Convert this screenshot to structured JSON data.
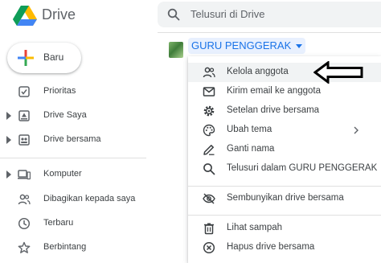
{
  "app": {
    "title": "Drive"
  },
  "search": {
    "placeholder": "Telusuri di Drive"
  },
  "new_button": {
    "label": "Baru"
  },
  "sidebar": {
    "items": [
      {
        "label": "Prioritas",
        "icon": "checkbox-icon",
        "expandable": false
      },
      {
        "label": "Drive Saya",
        "icon": "my-drive-icon",
        "expandable": true
      },
      {
        "label": "Drive bersama",
        "icon": "shared-drives-icon",
        "expandable": true
      },
      {
        "label": "Komputer",
        "icon": "computer-icon",
        "expandable": true
      },
      {
        "label": "Dibagikan kepada saya",
        "icon": "people-icon",
        "expandable": false
      },
      {
        "label": "Terbaru",
        "icon": "clock-icon",
        "expandable": false
      },
      {
        "label": "Berbintang",
        "icon": "star-icon",
        "expandable": false
      }
    ]
  },
  "breadcrumb": {
    "drive_name": "GURU PENGGERAK"
  },
  "menu": {
    "items": [
      {
        "label": "Kelola anggota",
        "icon": "manage-members-icon",
        "highlighted": true
      },
      {
        "label": "Kirim email ke anggota",
        "icon": "email-icon"
      },
      {
        "label": "Setelan drive bersama",
        "icon": "gear-icon"
      },
      {
        "label": "Ubah tema",
        "icon": "palette-icon",
        "submenu": true
      },
      {
        "label": "Ganti nama",
        "icon": "pencil-icon"
      },
      {
        "label": "Telusuri dalam GURU PENGGERAK",
        "icon": "search-icon"
      },
      {
        "label": "Sembunyikan drive bersama",
        "icon": "eye-off-icon"
      },
      {
        "label": "Lihat sampah",
        "icon": "trash-icon"
      },
      {
        "label": "Hapus drive bersama",
        "icon": "remove-circle-icon"
      }
    ]
  },
  "colors": {
    "accent": "#1a73e8",
    "highlight": "#f1f3f4",
    "text": "#3c4043"
  }
}
